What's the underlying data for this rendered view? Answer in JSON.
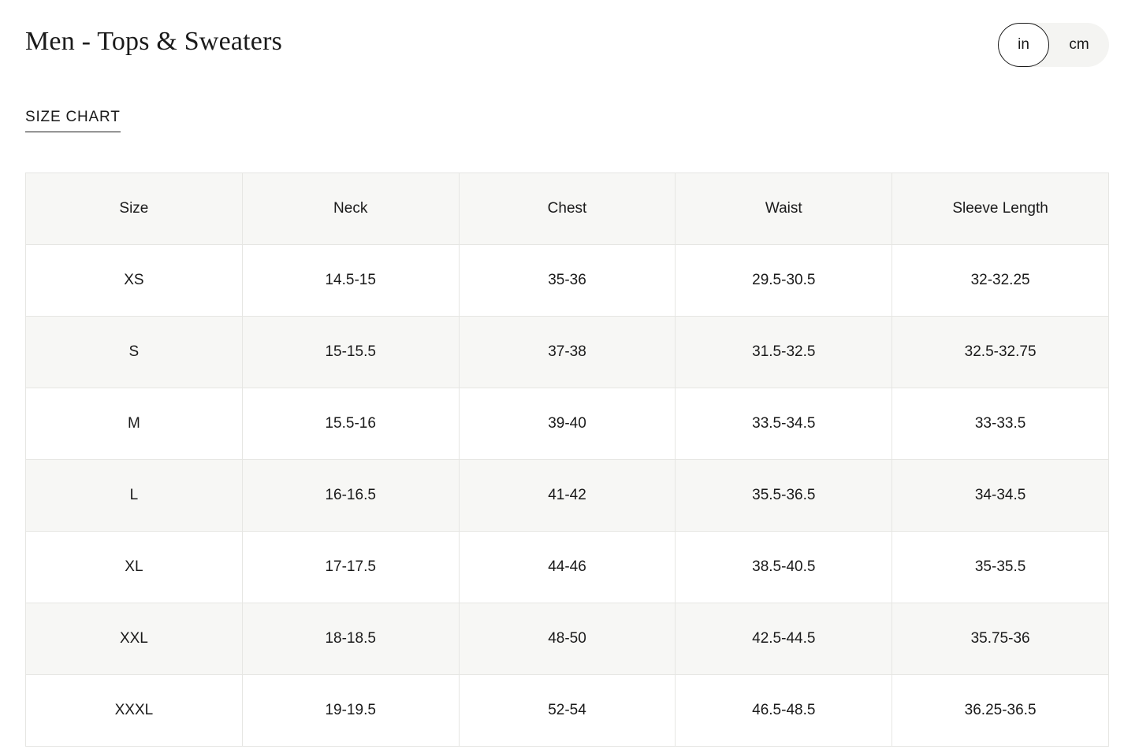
{
  "header": {
    "title": "Men - Tops & Sweaters"
  },
  "unit_toggle": {
    "options": [
      "in",
      "cm"
    ],
    "selected": "in"
  },
  "section": {
    "tab_label": "SIZE CHART"
  },
  "table": {
    "columns": [
      "Size",
      "Neck",
      "Chest",
      "Waist",
      "Sleeve Length"
    ],
    "rows": [
      [
        "XS",
        "14.5-15",
        "35-36",
        "29.5-30.5",
        "32-32.25"
      ],
      [
        "S",
        "15-15.5",
        "37-38",
        "31.5-32.5",
        "32.5-32.75"
      ],
      [
        "M",
        "15.5-16",
        "39-40",
        "33.5-34.5",
        "33-33.5"
      ],
      [
        "L",
        "16-16.5",
        "41-42",
        "35.5-36.5",
        "34-34.5"
      ],
      [
        "XL",
        "17-17.5",
        "44-46",
        "38.5-40.5",
        "35-35.5"
      ],
      [
        "XXL",
        "18-18.5",
        "48-50",
        "42.5-44.5",
        "35.75-36"
      ],
      [
        "XXXL",
        "19-19.5",
        "52-54",
        "46.5-48.5",
        "36.25-36.5"
      ]
    ]
  },
  "colors": {
    "text": "#1a1a1a",
    "header_bg": "#f7f7f5",
    "alt_row_bg": "#f7f7f5",
    "border": "#e6e6e3",
    "toggle_bg": "#f4f4f2"
  }
}
